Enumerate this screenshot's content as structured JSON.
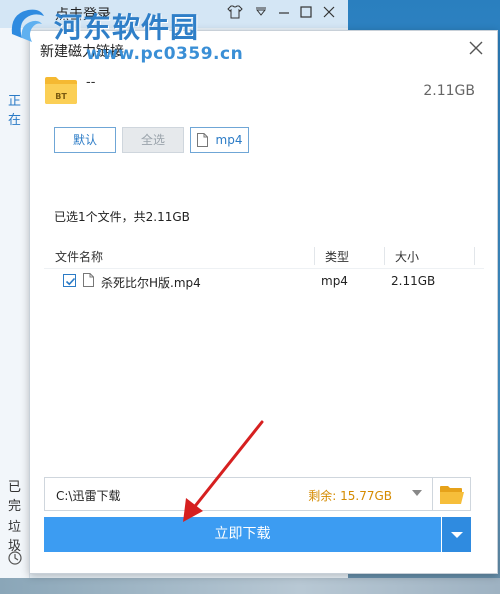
{
  "watermark": {
    "title": "河东软件园",
    "url": "www.pc0359.cn"
  },
  "background_app": {
    "login_label": "点击登录",
    "sidebar_item_1": "正在",
    "sidebar_item_2": "已完",
    "sidebar_item_3": "垃圾"
  },
  "dialog": {
    "title": "新建磁力链接",
    "task_name": "--",
    "task_size": "2.11GB",
    "filters": {
      "default_label": "默认",
      "select_all_label": "全选",
      "ext_label": "mp4"
    },
    "summary": "已选1个文件，共2.11GB",
    "table": {
      "headers": [
        "文件名称",
        "类型",
        "大小"
      ],
      "rows": [
        {
          "checked": true,
          "name": "杀死比尔H版.mp4",
          "type": "mp4",
          "size": "2.11GB"
        }
      ]
    },
    "save_path": "C:\\迅雷下载",
    "free_space": "剩余: 15.77GB",
    "download_label": "立即下载"
  },
  "colors": {
    "accent": "#3c9cf2",
    "free_space": "#d58b00",
    "annotation_arrow": "#d62020"
  }
}
